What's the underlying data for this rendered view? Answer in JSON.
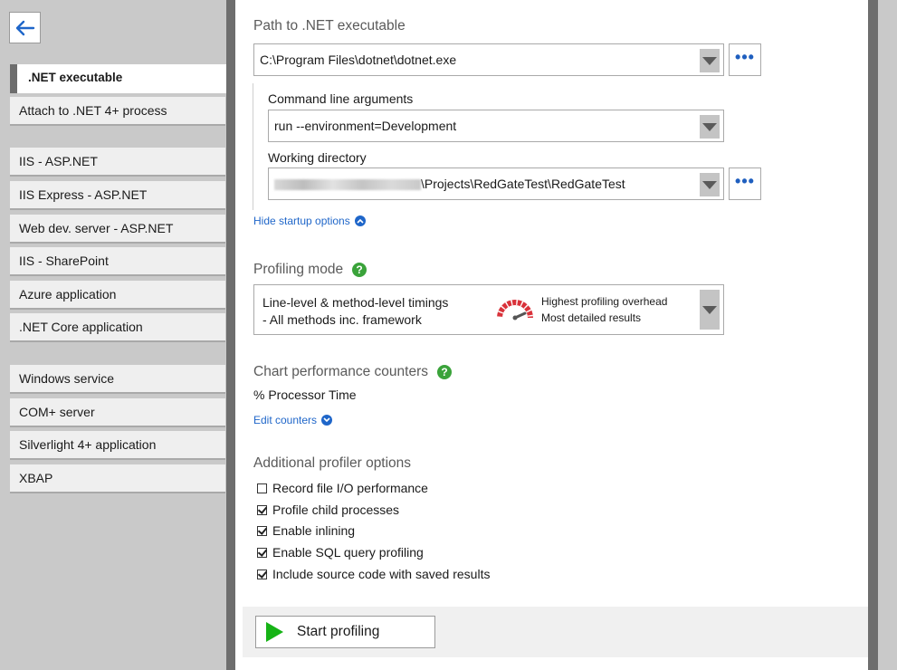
{
  "sidebar": {
    "items": [
      {
        "label": ".NET executable",
        "active": true
      },
      {
        "label": "Attach to .NET 4+ process"
      },
      {
        "label": "IIS - ASP.NET"
      },
      {
        "label": "IIS Express - ASP.NET"
      },
      {
        "label": "Web dev. server - ASP.NET"
      },
      {
        "label": "IIS - SharePoint"
      },
      {
        "label": "Azure application"
      },
      {
        "label": ".NET Core application"
      },
      {
        "label": "Windows service"
      },
      {
        "label": "COM+ server"
      },
      {
        "label": "Silverlight 4+ application"
      },
      {
        "label": "XBAP"
      }
    ]
  },
  "executable": {
    "title": "Path to .NET executable",
    "path_value": "C:\\Program Files\\dotnet\\dotnet.exe",
    "args_label": "Command line arguments",
    "args_value": "run --environment=Development",
    "workdir_label": "Working directory",
    "workdir_value": "\\Projects\\RedGateTest\\RedGateTest",
    "ellipsis": "•••",
    "hide_startup_link": "Hide startup options"
  },
  "profiling_mode": {
    "title": "Profiling mode",
    "help": "?",
    "mode_line1": "Line-level & method-level timings",
    "mode_line2": "- All methods inc. framework",
    "detail_line1": "Highest profiling overhead",
    "detail_line2": "Most detailed results"
  },
  "counters": {
    "title": "Chart performance counters",
    "help": "?",
    "value": "% Processor Time",
    "edit_link": "Edit counters"
  },
  "options": {
    "title": "Additional profiler options",
    "items": [
      {
        "label": "Record file I/O performance",
        "checked": false
      },
      {
        "label": "Profile child processes",
        "checked": true
      },
      {
        "label": "Enable inlining",
        "checked": true
      },
      {
        "label": "Enable SQL query profiling",
        "checked": true
      },
      {
        "label": "Include source code with saved results",
        "checked": true
      }
    ]
  },
  "footer": {
    "start_label": "Start profiling"
  },
  "colors": {
    "accent": "#1f66c9",
    "help_green": "#3aa33a",
    "play_green": "#16b316",
    "gauge_red": "#d9323a"
  }
}
